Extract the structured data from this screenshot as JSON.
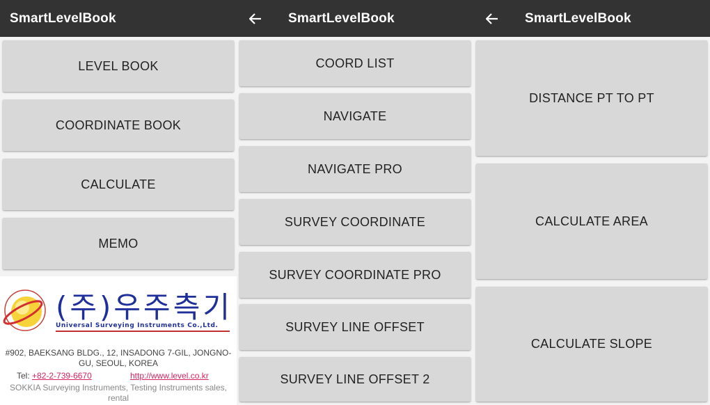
{
  "screens": [
    {
      "title": "SmartLevelBook",
      "buttons": [
        "LEVEL BOOK",
        "COORDINATE BOOK",
        "CALCULATE",
        "MEMO"
      ],
      "company": {
        "korean_name": "(주)우주측기",
        "english_name": "Universal Surveying Instruments Co.,Ltd.",
        "address": "#902, BAEKSANG BLDG., 12, INSADONG 7-GIL, JONGNO-GU, SEOUL, KOREA",
        "tel_label": "Tel:",
        "tel": "+82-2-739-6670",
        "website": "http://www.level.co.kr",
        "dealer": "SOKKIA Surveying Instruments, Testing Instruments sales, rental"
      }
    },
    {
      "title": "SmartLevelBook",
      "buttons": [
        "COORD LIST",
        "NAVIGATE",
        "NAVIGATE PRO",
        "SURVEY COORDINATE",
        "SURVEY COORDINATE PRO",
        "SURVEY LINE OFFSET",
        "SURVEY LINE OFFSET 2"
      ]
    },
    {
      "title": "SmartLevelBook",
      "buttons": [
        "DISTANCE PT TO PT",
        "CALCULATE AREA",
        "CALCULATE SLOPE"
      ]
    }
  ],
  "icons": {
    "back": "arrow-left-icon",
    "logo": "globe-logo-icon"
  },
  "colors": {
    "appbar": "#333333",
    "button": "#d8d8d8",
    "panel_bg": "#f3f3f3",
    "logo_blue": "#1f2f9a",
    "link": "#d0245f"
  }
}
